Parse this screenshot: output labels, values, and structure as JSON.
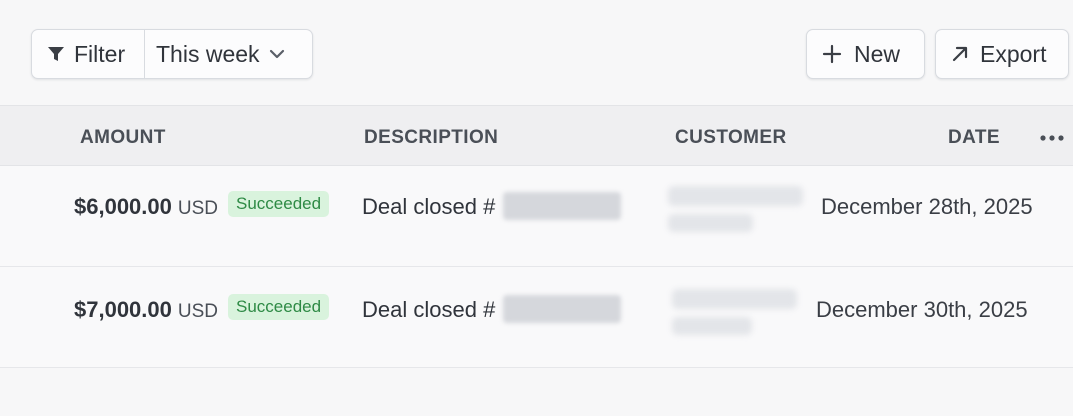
{
  "toolbar": {
    "filter_label": "Filter",
    "period_label": "This week",
    "new_label": "New",
    "export_label": "Export"
  },
  "table": {
    "columns": {
      "amount": "AMOUNT",
      "description": "DESCRIPTION",
      "customer": "CUSTOMER",
      "date": "DATE"
    },
    "rows": [
      {
        "amount": "$6,000.00",
        "currency": "USD",
        "status": "Succeeded",
        "description": "Deal closed #",
        "date": "December 28th, 2025"
      },
      {
        "amount": "$7,000.00",
        "currency": "USD",
        "status": "Succeeded",
        "description": "Deal closed #",
        "date": "December 30th, 2025"
      }
    ]
  },
  "colors": {
    "status_bg": "#d9f3dd",
    "status_text": "#2e8a45",
    "header_bg": "#efeff1"
  },
  "icons": {
    "filter": "filter-funnel-icon",
    "period": "chevron-down-icon",
    "new": "plus-icon",
    "export": "arrow-up-right-icon",
    "more": "more-horizontal-icon"
  }
}
